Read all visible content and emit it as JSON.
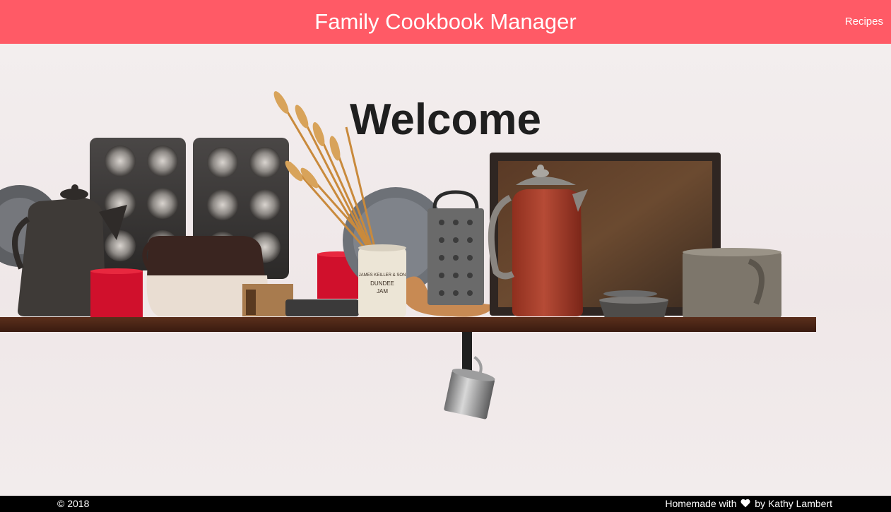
{
  "header": {
    "title": "Family Cookbook Manager",
    "nav_recipes": "Recipes",
    "background_color": "#ff5a66"
  },
  "hero": {
    "heading": "Welcome",
    "jar_label": [
      "JAMES KEILLER & SON",
      "DUNDEE",
      "JAM"
    ]
  },
  "footer": {
    "copyright": "© 2018",
    "credit_prefix": "Homemade with",
    "credit_icon": "heart-icon",
    "credit_suffix": "by Kathy Lambert"
  }
}
